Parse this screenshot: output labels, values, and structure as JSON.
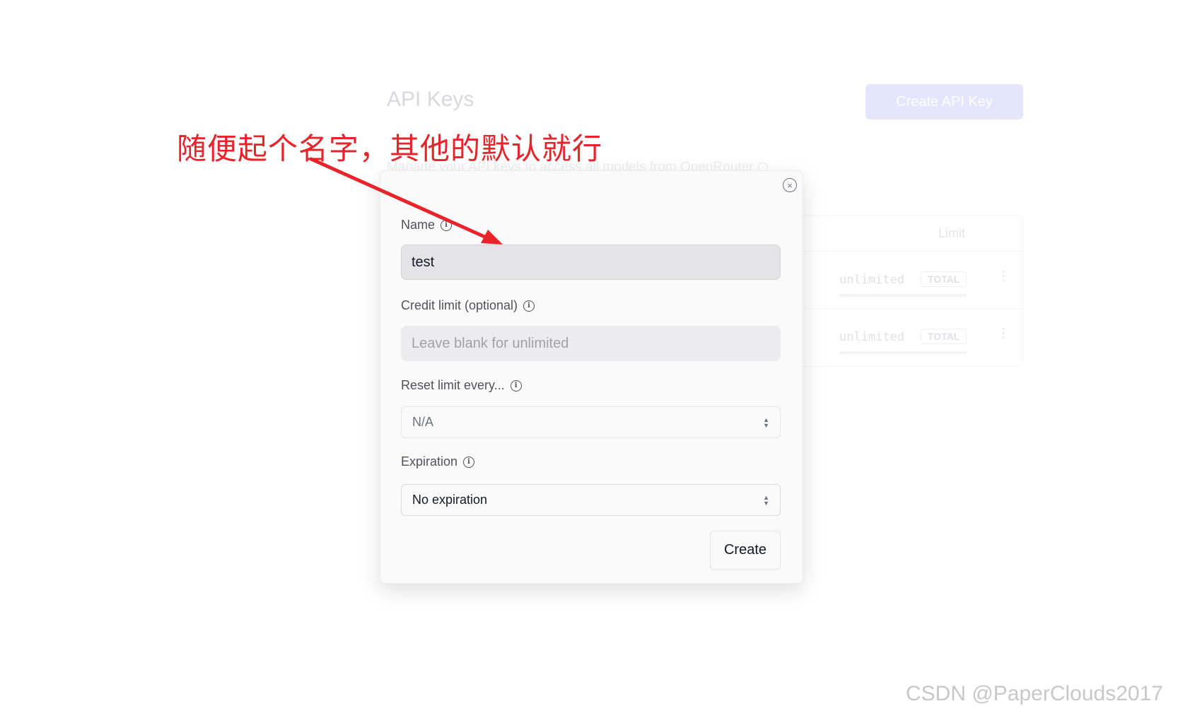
{
  "background": {
    "title": "API Keys",
    "subtitle": "Manage your API keys to access all models from OpenRouter",
    "create_button": "Create API Key",
    "table": {
      "header_limit": "Limit",
      "rows": [
        {
          "limit": "unlimited",
          "badge": "TOTAL"
        },
        {
          "limit": "unlimited",
          "badge": "TOTAL"
        }
      ]
    }
  },
  "modal": {
    "close_glyph": "×",
    "name": {
      "label": "Name",
      "value": "test"
    },
    "credit_limit": {
      "label": "Credit limit (optional)",
      "placeholder": "Leave blank for unlimited",
      "value": ""
    },
    "reset_limit": {
      "label": "Reset limit every...",
      "selected": "N/A"
    },
    "expiration": {
      "label": "Expiration",
      "selected": "No expiration"
    },
    "create_button": "Create",
    "info_glyph": "i"
  },
  "annotation": {
    "text": "随便起个名字，其他的默认就行",
    "color": "#e8232a"
  },
  "watermark": "CSDN @PaperClouds2017"
}
